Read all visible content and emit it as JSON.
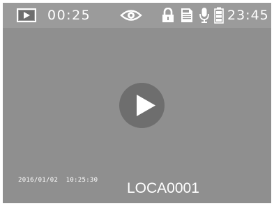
{
  "status_bar": {
    "mode_icon": "video-playback-icon",
    "elapsed_time": "00:25",
    "icons": [
      "eye-icon",
      "lock-icon",
      "sd-card-icon",
      "microphone-icon",
      "battery-icon"
    ],
    "clock": "23:45"
  },
  "playback": {
    "play_icon": "play-icon",
    "recorded_at": "2016/01/02  10:25:30",
    "file_name": "LOCA0001"
  },
  "colors": {
    "screen_background": "#8f8f8f",
    "status_bar_background": "#9b9b9b",
    "play_button": "#6e6e6e",
    "text": "#ffffff"
  }
}
